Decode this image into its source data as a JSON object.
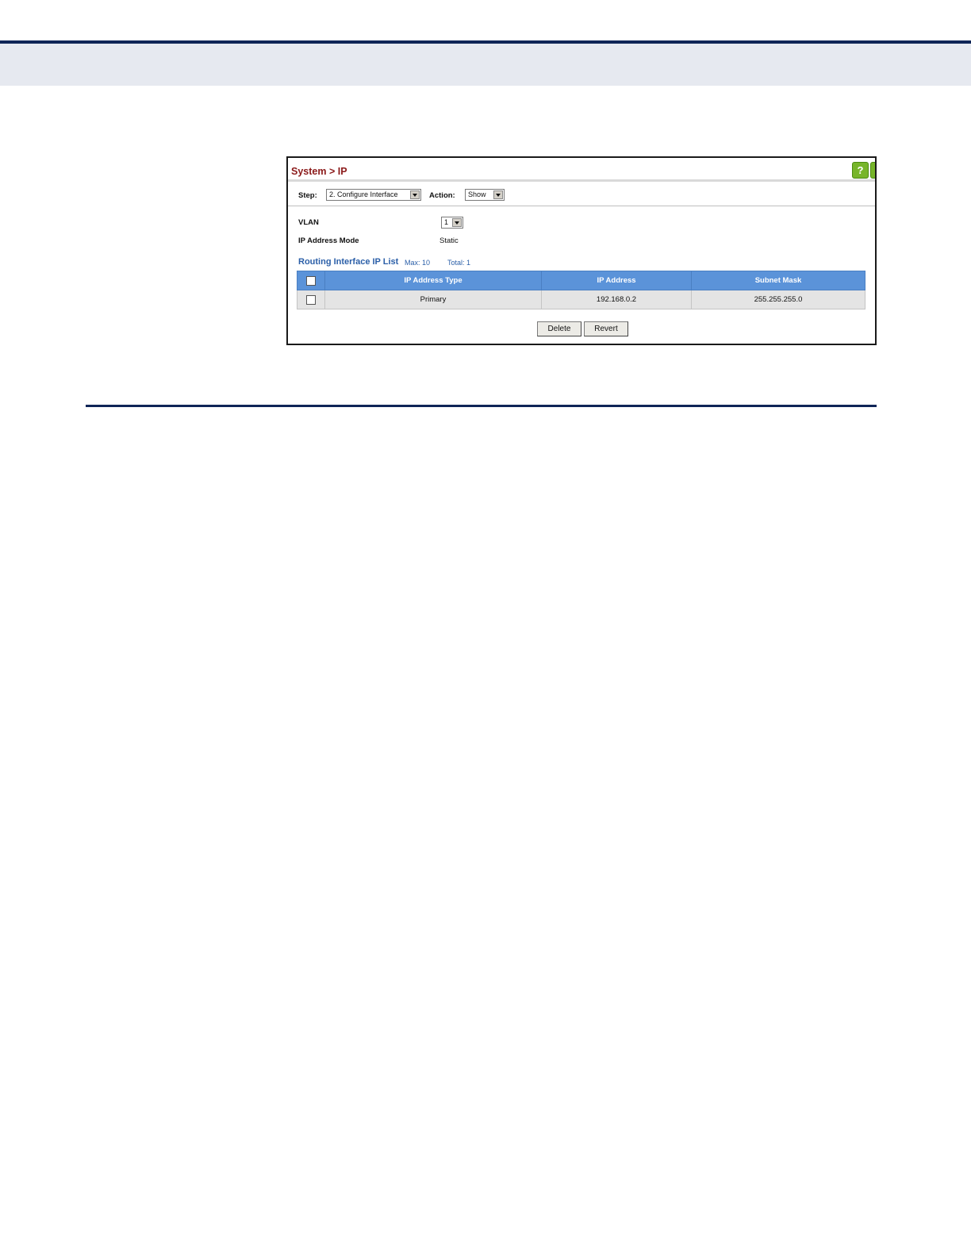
{
  "breadcrumb": {
    "title": "System > IP",
    "help_glyph": "?"
  },
  "toolbar": {
    "step_label": "Step:",
    "step_value": "2. Configure Interface",
    "action_label": "Action:",
    "action_value": "Show"
  },
  "form": {
    "vlan_label": "VLAN",
    "vlan_value": "1",
    "mode_label": "IP Address Mode",
    "mode_value": "Static"
  },
  "list": {
    "title": "Routing Interface IP List",
    "max": "Max: 10",
    "total": "Total: 1",
    "columns": [
      "IP Address Type",
      "IP Address",
      "Subnet Mask"
    ],
    "rows": [
      {
        "type": "Primary",
        "ip": "192.168.0.2",
        "mask": "255.255.255.0"
      }
    ]
  },
  "buttons": {
    "delete": "Delete",
    "revert": "Revert"
  },
  "colors": {
    "title": "#8b1a1a",
    "header": "#5b93d9",
    "section": "#2b5fa8",
    "rule": "#0f2557"
  }
}
